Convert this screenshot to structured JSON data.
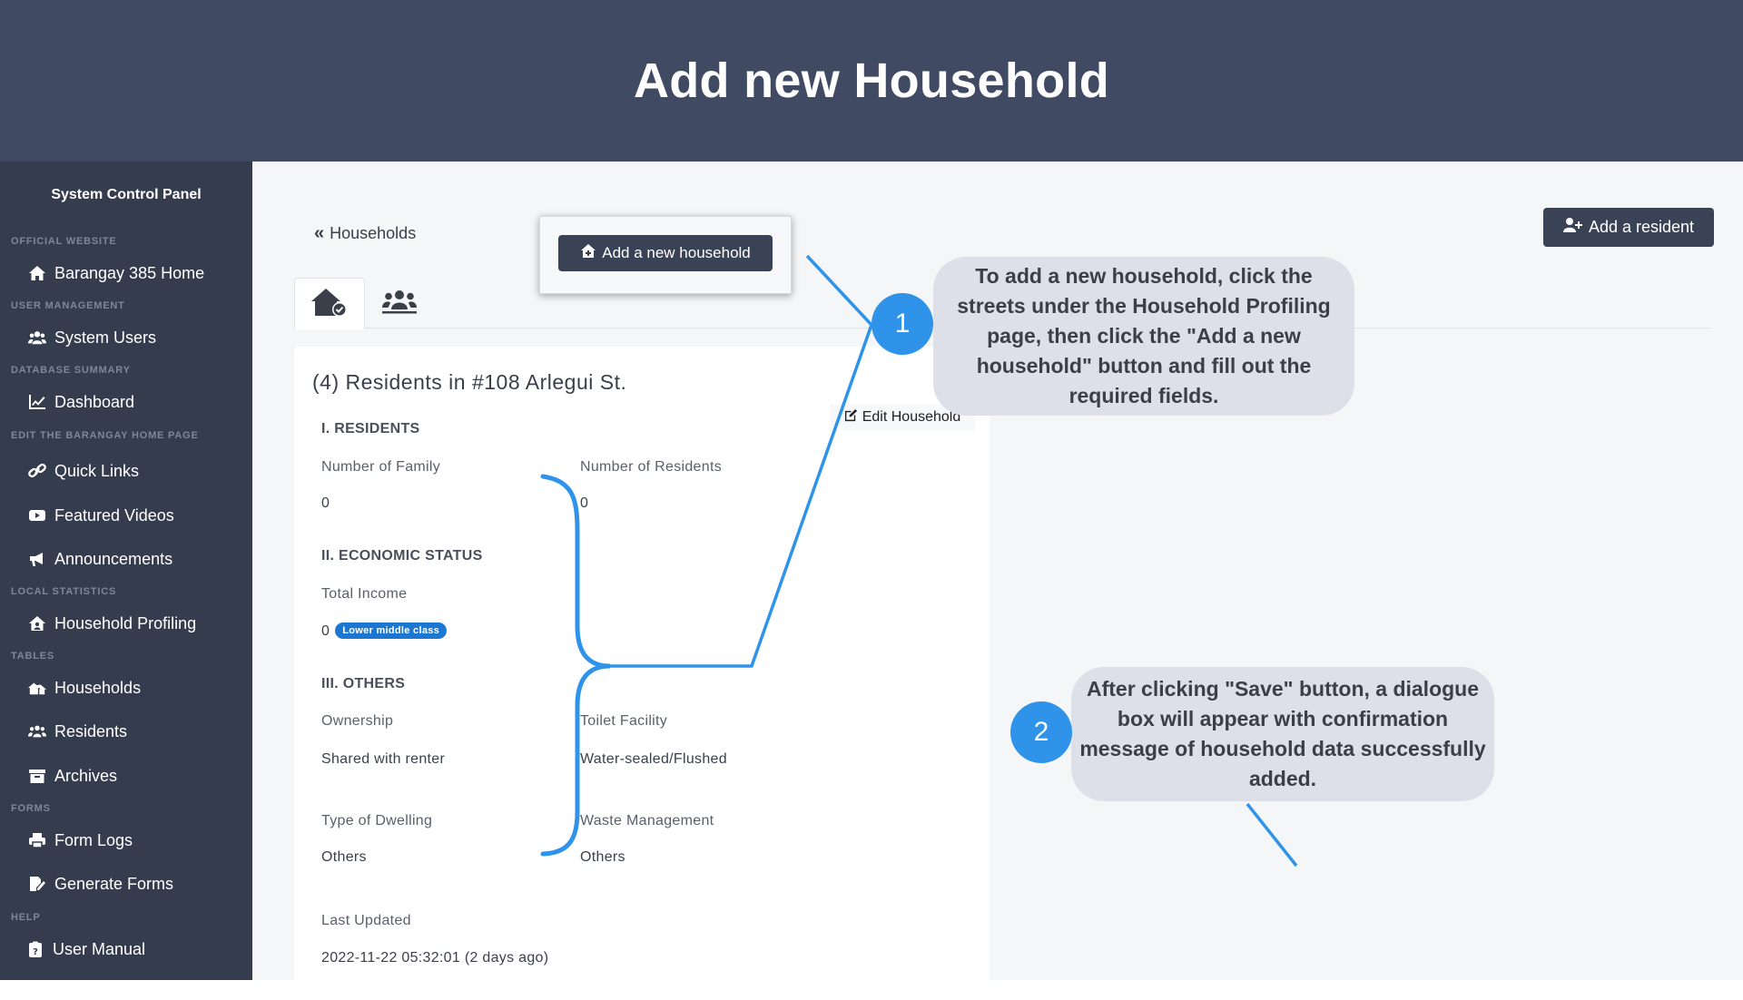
{
  "banner": {
    "title": "Add new Household"
  },
  "sidebar": {
    "title": "System Control Panel",
    "sections": {
      "official_website": "OFFICIAL WEBSITE",
      "user_management": "USER MANAGEMENT",
      "database_summary": "DATABASE SUMMARY",
      "edit_home": "EDIT THE BARANGAY HOME PAGE",
      "local_statistics": "LOCAL STATISTICS",
      "tables": "TABLES",
      "forms": "FORMS",
      "help": "HELP"
    },
    "items": {
      "home": "Barangay 385 Home",
      "system_users": "System Users",
      "dashboard": "Dashboard",
      "quick_links": "Quick Links",
      "featured_videos": "Featured Videos",
      "announcements": "Announcements",
      "household_profiling": "Household Profiling",
      "households": "Households",
      "residents": "Residents",
      "archives": "Archives",
      "form_logs": "Form Logs",
      "generate_forms": "Generate Forms",
      "user_manual": "User Manual"
    }
  },
  "main": {
    "back_label": "Households",
    "add_household_label": "Add a new household",
    "add_resident_label": "Add a resident",
    "card": {
      "title": "(4) Residents in #108 Arlegui St.",
      "edit_label": "Edit Household",
      "residents_heading": "I. RESIDENTS",
      "number_of_family_label": "Number of Family",
      "number_of_family_value": "0",
      "number_of_residents_label": "Number of Residents",
      "number_of_residents_value": "0",
      "economic_heading": "II. ECONOMIC STATUS",
      "total_income_label": "Total Income",
      "total_income_value": "0",
      "income_badge": "Lower middle class",
      "others_heading": "III. OTHERS",
      "ownership_label": "Ownership",
      "ownership_value": "Shared with renter",
      "toilet_label": "Toilet Facility",
      "toilet_value": "Water-sealed/Flushed",
      "dwelling_label": "Type of Dwelling",
      "dwelling_value": "Others",
      "waste_label": "Waste Management",
      "waste_value": "Others",
      "updated_label": "Last Updated",
      "updated_value": "2022-11-22 05:32:01 (2 days ago)"
    }
  },
  "annotations": {
    "step1_number": "1",
    "step1_text": "To add a new household, click the streets under the Household Profiling page, then click the \"Add a new household\" button and fill out the required fields.",
    "step2_number": "2",
    "step2_text": "After clicking \"Save\" button, a dialogue box will appear with confirmation message of household data successfully added."
  },
  "colors": {
    "banner": "#404b63",
    "sidebar": "#343c4e",
    "accent": "#2f93ea",
    "badge": "#1b77d2",
    "callout": "#dde0e8"
  }
}
